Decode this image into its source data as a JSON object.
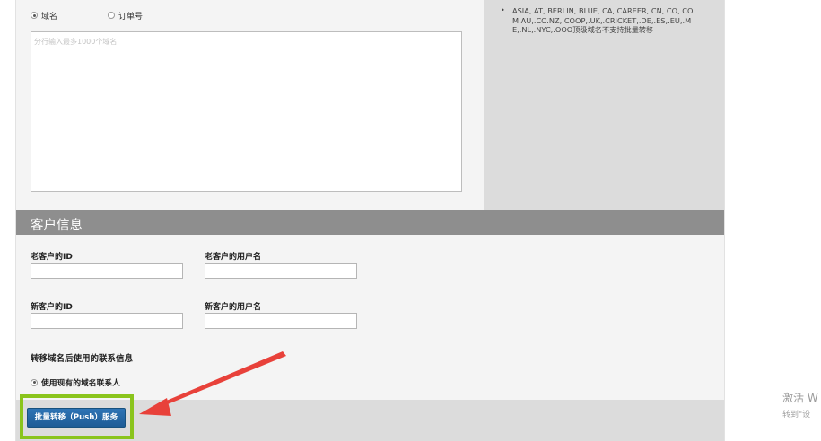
{
  "search_mode": {
    "options": [
      {
        "label": "域名",
        "selected": true
      },
      {
        "label": "订单号",
        "selected": false
      }
    ],
    "textarea_placeholder": "分行输入最多1000个域名"
  },
  "unsupported_note": "ASIA,.AT,.BERLIN,.BLUE,.CA,.CAREER,.CN,.CO,.COM.AU,.CO.NZ,.COOP,.UK,.CRICKET,.DE,.ES,.EU,.ME,.NL,.NYC,.OOO顶级域名不支持批量转移",
  "customer_info": {
    "title": "客户信息",
    "old_id_label": "老客户的ID",
    "old_username_label": "老客户的用户名",
    "new_id_label": "新客户的ID",
    "new_username_label": "新客户的用户名",
    "old_id_value": "",
    "old_username_value": "",
    "new_id_value": "",
    "new_username_value": ""
  },
  "contact": {
    "title": "转移域名后使用的联系信息",
    "option_label": "使用现有的域名联系人",
    "option_selected": true
  },
  "submit_label": "批量转移（Push）服务",
  "watermark": {
    "line1": "激活 W",
    "line2": "转到\"设"
  },
  "colors": {
    "section_header_bg": "#8e8e8e",
    "button_bg": "#2e74b5",
    "highlight_border": "#8ac41c",
    "arrow": "#e8413a"
  }
}
